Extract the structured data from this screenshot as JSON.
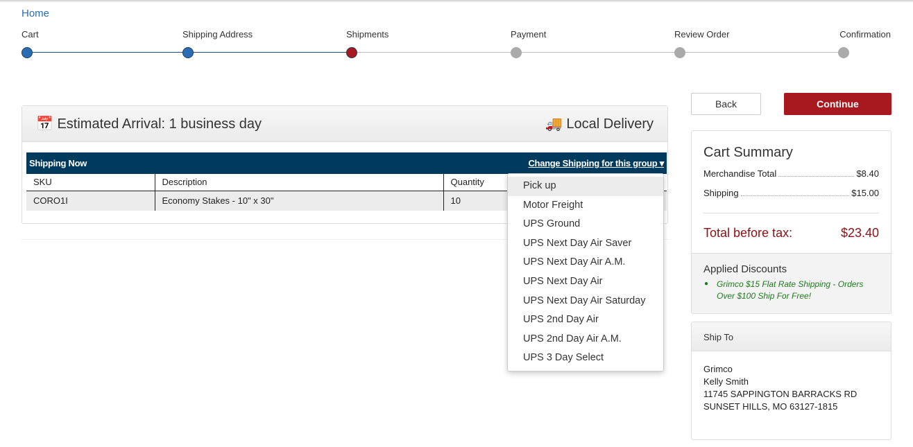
{
  "breadcrumb": {
    "home": "Home"
  },
  "steps": [
    {
      "label": "Cart",
      "state": "done"
    },
    {
      "label": "Shipping Address",
      "state": "done"
    },
    {
      "label": "Shipments",
      "state": "current"
    },
    {
      "label": "Payment",
      "state": "todo"
    },
    {
      "label": "Review Order",
      "state": "todo"
    },
    {
      "label": "Confirmation",
      "state": "todo"
    }
  ],
  "colors": {
    "done": "#2a6db5",
    "current": "#a8181f",
    "todo": "#aaaaaa",
    "header": "#003a5c"
  },
  "shipment": {
    "arrival": "Estimated Arrival: 1 business day",
    "method": "Local Delivery",
    "group": "Shipping Now",
    "change_link": "Change Shipping for this group",
    "columns": [
      "SKU",
      "Description",
      "Quantity"
    ],
    "rows": [
      [
        "CORO1I",
        "Economy Stakes - 10\" x 30\"",
        "10"
      ]
    ]
  },
  "shipping_options": {
    "selected": "Pick up",
    "options": [
      "Pick up",
      "Motor Freight",
      "UPS Ground",
      "UPS Next Day Air Saver",
      "UPS Next Day Air A.M.",
      "UPS Next Day Air",
      "UPS Next Day Air Saturday",
      "UPS 2nd Day Air",
      "UPS 2nd Day Air A.M.",
      "UPS 3 Day Select"
    ]
  },
  "actions": {
    "back": "Back",
    "continue": "Continue"
  },
  "summary": {
    "title": "Cart Summary",
    "merch_label": "Merchandise Total",
    "merch": "$8.40",
    "ship_label": "Shipping",
    "ship": "$15.00",
    "total_label": "Total before tax:",
    "total": "$23.40",
    "discounts_title": "Applied Discounts",
    "discount": "Grimco $15 Flat Rate Shipping - Orders Over $100 Ship For Free!"
  },
  "ship_to": {
    "title": "Ship To",
    "lines": [
      "Grimco",
      "Kelly Smith",
      "11745 SAPPINGTON BARRACKS RD",
      "SUNSET HILLS, MO 63127-1815"
    ]
  }
}
